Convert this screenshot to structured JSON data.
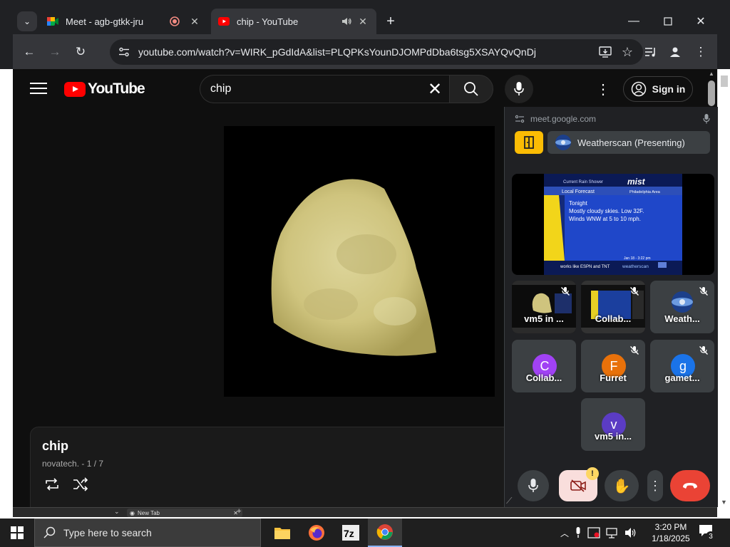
{
  "browser": {
    "tabs": [
      {
        "title": "Meet - agb-gtkk-jru"
      },
      {
        "title": "chip - YouTube"
      }
    ],
    "url": "youtube.com/watch?v=WIRK_pGdIdA&list=PLQPKsYounDJOMPdDba6tsg5XSAYQvQnDj"
  },
  "youtube": {
    "logo_text": "YouTube",
    "search_value": "chip",
    "sign_in_label": "Sign in",
    "playlist_title": "chip",
    "playlist_meta": "novatech. - 1 / 7"
  },
  "meet": {
    "site": "meet.google.com",
    "presenting_label": "Weatherscan (Presenting)",
    "weather_screen": {
      "header": "Current Rain Shower",
      "brand": "mist",
      "section": "Local Forecast",
      "region": "Philadelphia Area",
      "forecast_line1": "Tonight",
      "forecast_line2": "Mostly cloudy skies. Low 32F.",
      "forecast_line3": "Winds WNW at 5 to 10 mph.",
      "date_stamp": "Jan 18 - 3:22 pm",
      "ticker": "works like ESPN and TNT",
      "footer_brand": "weatherscan"
    },
    "participants": [
      {
        "name": "vm5 in ...",
        "avatar": "",
        "color": "",
        "muted": true
      },
      {
        "name": "Collab...",
        "avatar": "",
        "color": "",
        "muted": true
      },
      {
        "name": "Weath...",
        "avatar": "",
        "color": "",
        "muted": true
      },
      {
        "name": "Collab...",
        "avatar": "C",
        "color": "#a142f4",
        "muted": false
      },
      {
        "name": "Furret",
        "avatar": "F",
        "color": "#e8710a",
        "muted": true
      },
      {
        "name": "gamet...",
        "avatar": "g",
        "color": "#1a73e8",
        "muted": true
      },
      {
        "name": "vm5 in...",
        "avatar": "v",
        "color": "#5b3cc4",
        "muted": false
      }
    ],
    "camera_alert": "!"
  },
  "bottom_strip": {
    "new_tab_label": "New Tab"
  },
  "taskbar": {
    "search_placeholder": "Type here to search",
    "time": "3:20 PM",
    "date": "1/18/2025",
    "notification_count": "3"
  }
}
